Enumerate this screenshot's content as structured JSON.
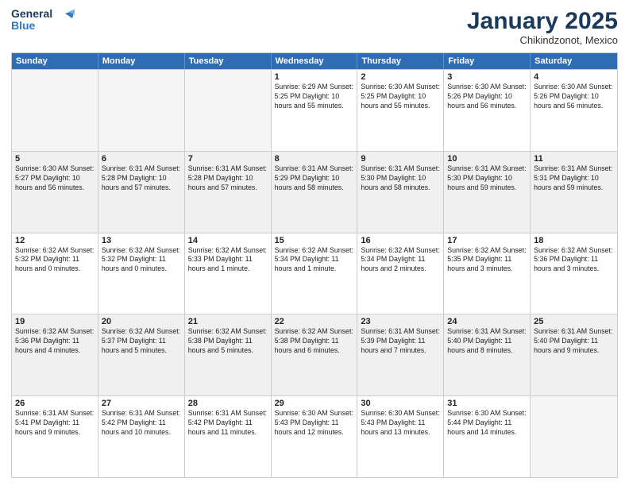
{
  "logo": {
    "line1": "General",
    "line2": "Blue"
  },
  "title": "January 2025",
  "subtitle": "Chikindzonot, Mexico",
  "days": [
    "Sunday",
    "Monday",
    "Tuesday",
    "Wednesday",
    "Thursday",
    "Friday",
    "Saturday"
  ],
  "rows": [
    [
      {
        "day": "",
        "info": "",
        "empty": true
      },
      {
        "day": "",
        "info": "",
        "empty": true
      },
      {
        "day": "",
        "info": "",
        "empty": true
      },
      {
        "day": "1",
        "info": "Sunrise: 6:29 AM\nSunset: 5:25 PM\nDaylight: 10 hours\nand 55 minutes."
      },
      {
        "day": "2",
        "info": "Sunrise: 6:30 AM\nSunset: 5:25 PM\nDaylight: 10 hours\nand 55 minutes."
      },
      {
        "day": "3",
        "info": "Sunrise: 6:30 AM\nSunset: 5:26 PM\nDaylight: 10 hours\nand 56 minutes."
      },
      {
        "day": "4",
        "info": "Sunrise: 6:30 AM\nSunset: 5:26 PM\nDaylight: 10 hours\nand 56 minutes."
      }
    ],
    [
      {
        "day": "5",
        "info": "Sunrise: 6:30 AM\nSunset: 5:27 PM\nDaylight: 10 hours\nand 56 minutes.",
        "shaded": true
      },
      {
        "day": "6",
        "info": "Sunrise: 6:31 AM\nSunset: 5:28 PM\nDaylight: 10 hours\nand 57 minutes.",
        "shaded": true
      },
      {
        "day": "7",
        "info": "Sunrise: 6:31 AM\nSunset: 5:28 PM\nDaylight: 10 hours\nand 57 minutes.",
        "shaded": true
      },
      {
        "day": "8",
        "info": "Sunrise: 6:31 AM\nSunset: 5:29 PM\nDaylight: 10 hours\nand 58 minutes.",
        "shaded": true
      },
      {
        "day": "9",
        "info": "Sunrise: 6:31 AM\nSunset: 5:30 PM\nDaylight: 10 hours\nand 58 minutes.",
        "shaded": true
      },
      {
        "day": "10",
        "info": "Sunrise: 6:31 AM\nSunset: 5:30 PM\nDaylight: 10 hours\nand 59 minutes.",
        "shaded": true
      },
      {
        "day": "11",
        "info": "Sunrise: 6:31 AM\nSunset: 5:31 PM\nDaylight: 10 hours\nand 59 minutes.",
        "shaded": true
      }
    ],
    [
      {
        "day": "12",
        "info": "Sunrise: 6:32 AM\nSunset: 5:32 PM\nDaylight: 11 hours\nand 0 minutes."
      },
      {
        "day": "13",
        "info": "Sunrise: 6:32 AM\nSunset: 5:32 PM\nDaylight: 11 hours\nand 0 minutes."
      },
      {
        "day": "14",
        "info": "Sunrise: 6:32 AM\nSunset: 5:33 PM\nDaylight: 11 hours\nand 1 minute."
      },
      {
        "day": "15",
        "info": "Sunrise: 6:32 AM\nSunset: 5:34 PM\nDaylight: 11 hours\nand 1 minute."
      },
      {
        "day": "16",
        "info": "Sunrise: 6:32 AM\nSunset: 5:34 PM\nDaylight: 11 hours\nand 2 minutes."
      },
      {
        "day": "17",
        "info": "Sunrise: 6:32 AM\nSunset: 5:35 PM\nDaylight: 11 hours\nand 3 minutes."
      },
      {
        "day": "18",
        "info": "Sunrise: 6:32 AM\nSunset: 5:36 PM\nDaylight: 11 hours\nand 3 minutes."
      }
    ],
    [
      {
        "day": "19",
        "info": "Sunrise: 6:32 AM\nSunset: 5:36 PM\nDaylight: 11 hours\nand 4 minutes.",
        "shaded": true
      },
      {
        "day": "20",
        "info": "Sunrise: 6:32 AM\nSunset: 5:37 PM\nDaylight: 11 hours\nand 5 minutes.",
        "shaded": true
      },
      {
        "day": "21",
        "info": "Sunrise: 6:32 AM\nSunset: 5:38 PM\nDaylight: 11 hours\nand 5 minutes.",
        "shaded": true
      },
      {
        "day": "22",
        "info": "Sunrise: 6:32 AM\nSunset: 5:38 PM\nDaylight: 11 hours\nand 6 minutes.",
        "shaded": true
      },
      {
        "day": "23",
        "info": "Sunrise: 6:31 AM\nSunset: 5:39 PM\nDaylight: 11 hours\nand 7 minutes.",
        "shaded": true
      },
      {
        "day": "24",
        "info": "Sunrise: 6:31 AM\nSunset: 5:40 PM\nDaylight: 11 hours\nand 8 minutes.",
        "shaded": true
      },
      {
        "day": "25",
        "info": "Sunrise: 6:31 AM\nSunset: 5:40 PM\nDaylight: 11 hours\nand 9 minutes.",
        "shaded": true
      }
    ],
    [
      {
        "day": "26",
        "info": "Sunrise: 6:31 AM\nSunset: 5:41 PM\nDaylight: 11 hours\nand 9 minutes."
      },
      {
        "day": "27",
        "info": "Sunrise: 6:31 AM\nSunset: 5:42 PM\nDaylight: 11 hours\nand 10 minutes."
      },
      {
        "day": "28",
        "info": "Sunrise: 6:31 AM\nSunset: 5:42 PM\nDaylight: 11 hours\nand 11 minutes."
      },
      {
        "day": "29",
        "info": "Sunrise: 6:30 AM\nSunset: 5:43 PM\nDaylight: 11 hours\nand 12 minutes."
      },
      {
        "day": "30",
        "info": "Sunrise: 6:30 AM\nSunset: 5:43 PM\nDaylight: 11 hours\nand 13 minutes."
      },
      {
        "day": "31",
        "info": "Sunrise: 6:30 AM\nSunset: 5:44 PM\nDaylight: 11 hours\nand 14 minutes."
      },
      {
        "day": "",
        "info": "",
        "empty": true
      }
    ]
  ]
}
